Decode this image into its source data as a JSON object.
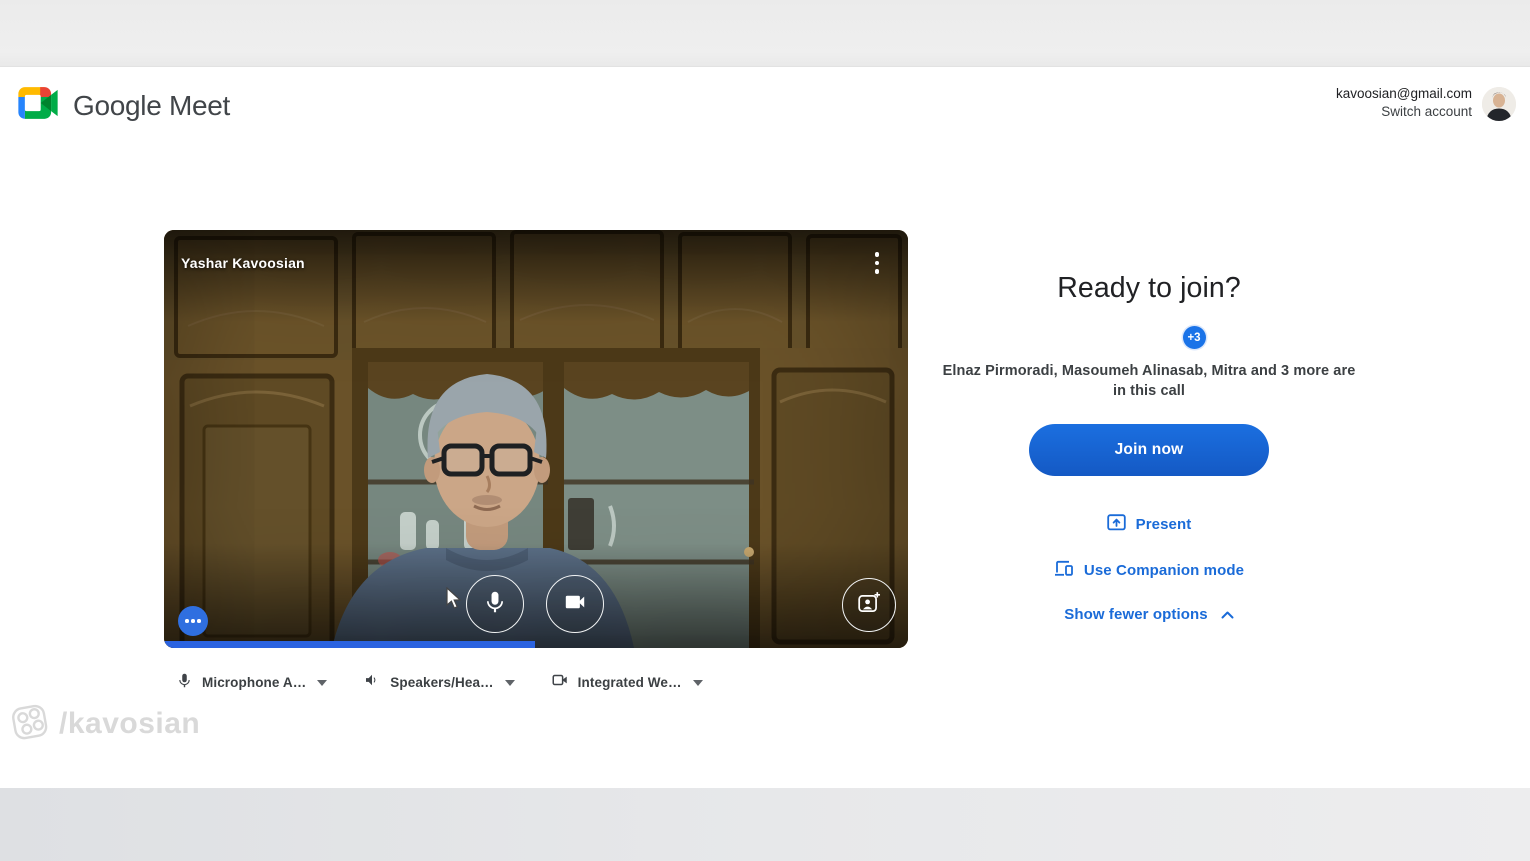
{
  "header": {
    "app_name": "Google Meet",
    "account_email": "kavoosian@gmail.com",
    "switch_account_label": "Switch account"
  },
  "video_preview": {
    "participant_name": "Yashar Kavoosian",
    "mic_meter_percent": 50
  },
  "device_bar": {
    "microphone_label": "Microphone A…",
    "speakers_label": "Speakers/Hea…",
    "camera_label": "Integrated We…"
  },
  "join_panel": {
    "title": "Ready to join?",
    "participants_badge": "+3",
    "participants_text": "Elnaz Pirmoradi, Masoumeh Alinasab, Mitra and 3 more are in this call",
    "join_button_label": "Join now",
    "present_label": "Present",
    "companion_label": "Use Companion mode",
    "fewer_options_label": "Show fewer options"
  },
  "watermark": {
    "text": "/kavosian"
  },
  "colors": {
    "accent_blue": "#1a73e8",
    "join_button_blue": "#1663d2",
    "meter_blue": "#2b63e0",
    "badge_blue": "#1a73e8"
  }
}
